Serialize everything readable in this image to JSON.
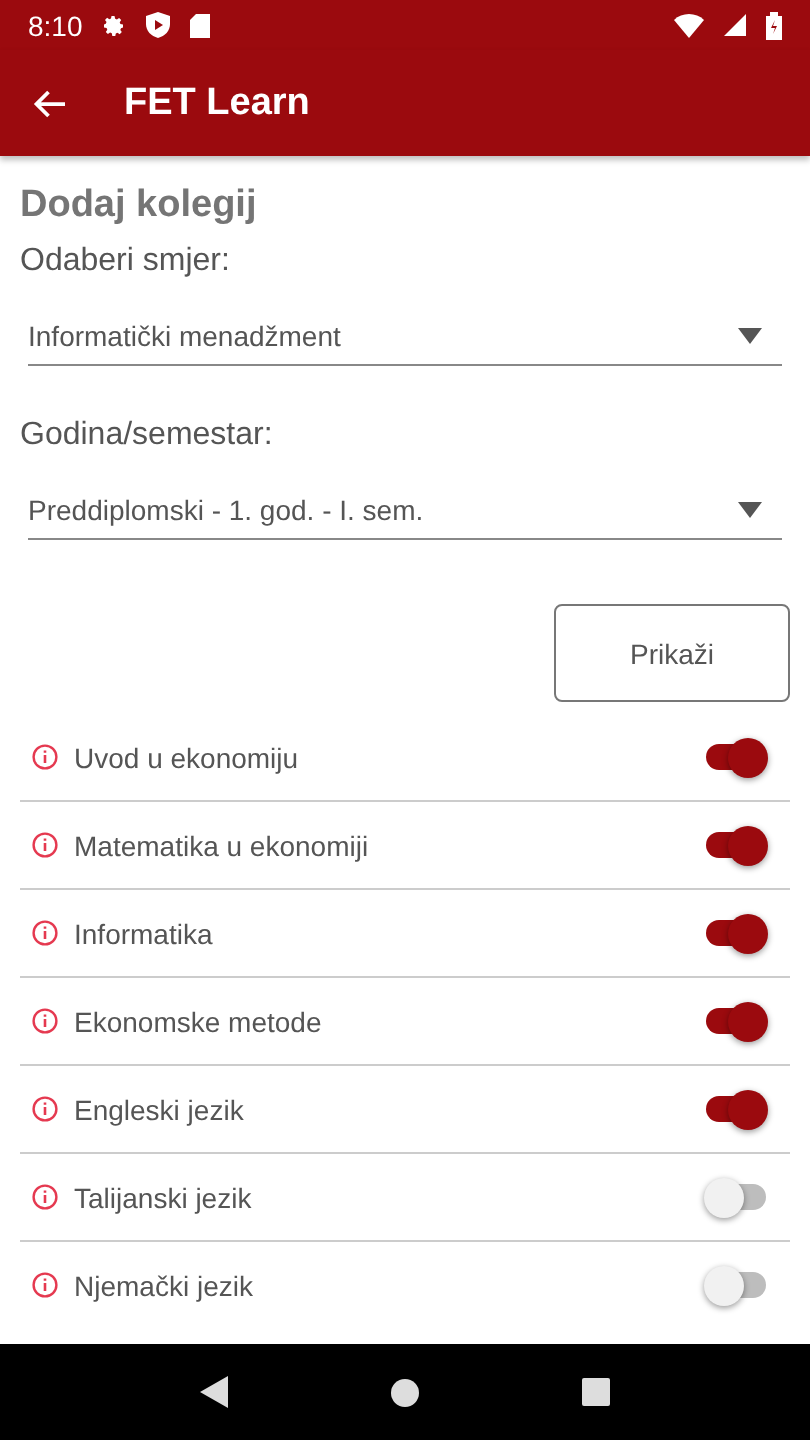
{
  "status_bar": {
    "time": "8:10"
  },
  "app_bar": {
    "title": "FET Learn"
  },
  "form": {
    "heading": "Dodaj kolegij",
    "fields": [
      {
        "label": "Odaberi smjer:",
        "value": "Informatički menadžment"
      },
      {
        "label": "Godina/semestar:",
        "value": "Preddiplomski - 1. god. - I. sem."
      }
    ],
    "button": "Prikaži"
  },
  "courses": [
    {
      "name": "Uvod u ekonomiju",
      "on": true
    },
    {
      "name": "Matematika u ekonomiji",
      "on": true
    },
    {
      "name": "Informatika",
      "on": true
    },
    {
      "name": "Ekonomske metode",
      "on": true
    },
    {
      "name": "Engleski jezik",
      "on": true
    },
    {
      "name": "Talijanski jezik",
      "on": false
    },
    {
      "name": "Njemački jezik",
      "on": false
    }
  ]
}
